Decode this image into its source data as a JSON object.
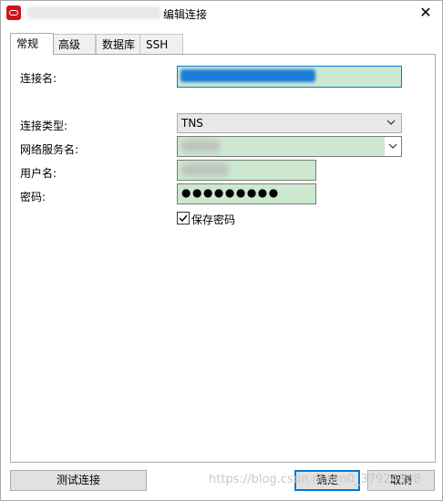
{
  "window": {
    "title": "编辑连接",
    "close_symbol": "✕"
  },
  "tabs": [
    {
      "label": "常规",
      "active": true
    },
    {
      "label": "高级"
    },
    {
      "label": "数据库"
    },
    {
      "label": "SSH"
    }
  ],
  "form": {
    "connection_name_label": "连接名:",
    "connection_type_label": "连接类型:",
    "connection_type_value": "TNS",
    "net_service_name_label": "网络服务名:",
    "username_label": "用户名:",
    "password_label": "密码:",
    "password_value": "●●●●●●●●●",
    "save_password_label": "保存密码",
    "save_password_checked": true
  },
  "buttons": {
    "test": "测试连接",
    "ok": "确定",
    "cancel": "取消"
  },
  "watermark": "https://blog.csdn.net/m0_37924308",
  "colors": {
    "field_green": "#cce8cf",
    "selection_blue": "#1b7bd8",
    "primary_border": "#0078d7"
  }
}
